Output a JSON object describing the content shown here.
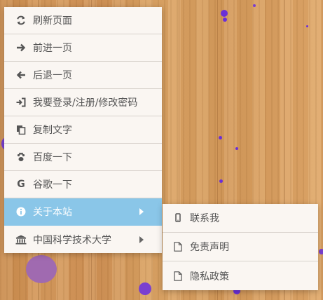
{
  "menu": {
    "items": [
      {
        "label": "刷新页面",
        "icon": "refresh-icon"
      },
      {
        "label": "前进一页",
        "icon": "arrow-right-icon"
      },
      {
        "label": "后退一页",
        "icon": "arrow-left-icon"
      },
      {
        "label": "我要登录/注册/修改密码",
        "icon": "sign-in-icon"
      },
      {
        "label": "复制文字",
        "icon": "copy-icon"
      },
      {
        "label": "百度一下",
        "icon": "paw-icon"
      },
      {
        "label": "谷歌一下",
        "icon": "google-icon"
      },
      {
        "label": "关于本站",
        "icon": "info-icon",
        "active": true
      },
      {
        "label": "中国科学技术大学",
        "icon": "university-icon"
      }
    ]
  },
  "submenu": {
    "items": [
      {
        "label": "联系我",
        "icon": "mobile-icon"
      },
      {
        "label": "免责声明",
        "icon": "file-icon"
      },
      {
        "label": "隐私政策",
        "icon": "file-icon"
      }
    ]
  },
  "colors": {
    "active": "#8ac6e8",
    "menu_bg": "#faf6f2",
    "dot": "#7a3fd0"
  }
}
